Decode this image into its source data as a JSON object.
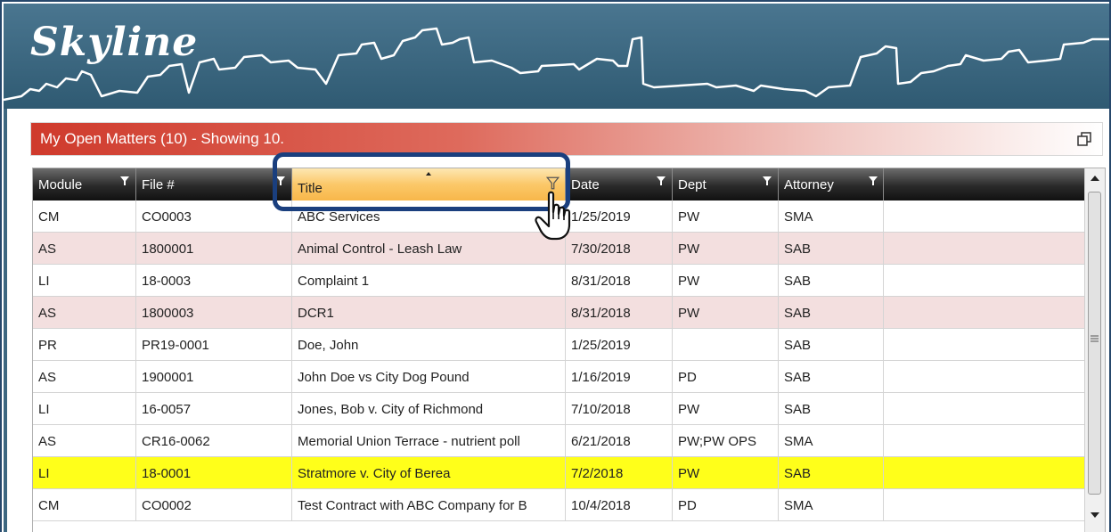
{
  "app": {
    "brand": "Skyline"
  },
  "panel": {
    "title": "My Open Matters (10) - Showing 10."
  },
  "grid": {
    "columns": [
      {
        "label": "Module"
      },
      {
        "label": "File #"
      },
      {
        "label": "Title"
      },
      {
        "label": "Date"
      },
      {
        "label": "Dept"
      },
      {
        "label": "Attorney"
      }
    ],
    "sorted_column": "Title",
    "rows": [
      {
        "module": "CM",
        "file": "CO0003",
        "title": "ABC Services",
        "date": "1/25/2019",
        "dept": "PW",
        "attorney": "SMA"
      },
      {
        "module": "AS",
        "file": "1800001",
        "title": "Animal Control - Leash Law",
        "date": "7/30/2018",
        "dept": "PW",
        "attorney": "SAB"
      },
      {
        "module": "LI",
        "file": "18-0003",
        "title": "Complaint 1",
        "date": "8/31/2018",
        "dept": "PW",
        "attorney": "SAB"
      },
      {
        "module": "AS",
        "file": "1800003",
        "title": "DCR1",
        "date": "8/31/2018",
        "dept": "PW",
        "attorney": "SAB"
      },
      {
        "module": "PR",
        "file": "PR19-0001",
        "title": "Doe, John",
        "date": "1/25/2019",
        "dept": "",
        "attorney": "SAB"
      },
      {
        "module": "AS",
        "file": "1900001",
        "title": "John Doe vs City Dog Pound",
        "date": "1/16/2019",
        "dept": "PD",
        "attorney": "SAB"
      },
      {
        "module": "LI",
        "file": "16-0057",
        "title": "Jones, Bob v. City of Richmond",
        "date": "7/10/2018",
        "dept": "PW",
        "attorney": "SAB"
      },
      {
        "module": "AS",
        "file": "CR16-0062",
        "title": "Memorial Union Terrace - nutrient poll",
        "date": "6/21/2018",
        "dept": "PW;PW OPS",
        "attorney": "SMA"
      },
      {
        "module": "LI",
        "file": "18-0001",
        "title": "Stratmore v. City of Berea",
        "date": "7/2/2018",
        "dept": "PW",
        "attorney": "SAB"
      },
      {
        "module": "CM",
        "file": "CO0002",
        "title": "Test Contract with ABC Company for B",
        "date": "10/4/2018",
        "dept": "PD",
        "attorney": "SMA"
      }
    ]
  },
  "colors": {
    "banner": "#2f5a72",
    "title_bar_red": "#cf3a2c",
    "alt_row": "#f3dfdf",
    "selected_row": "#ffff1a",
    "active_header": "#fbc869",
    "highlight_box": "#1a3f7e"
  },
  "icons": [
    "filter-icon",
    "restore-window-icon",
    "hand-pointer-icon",
    "scroll-up-icon",
    "scroll-down-icon",
    "sort-ascending-icon"
  ]
}
